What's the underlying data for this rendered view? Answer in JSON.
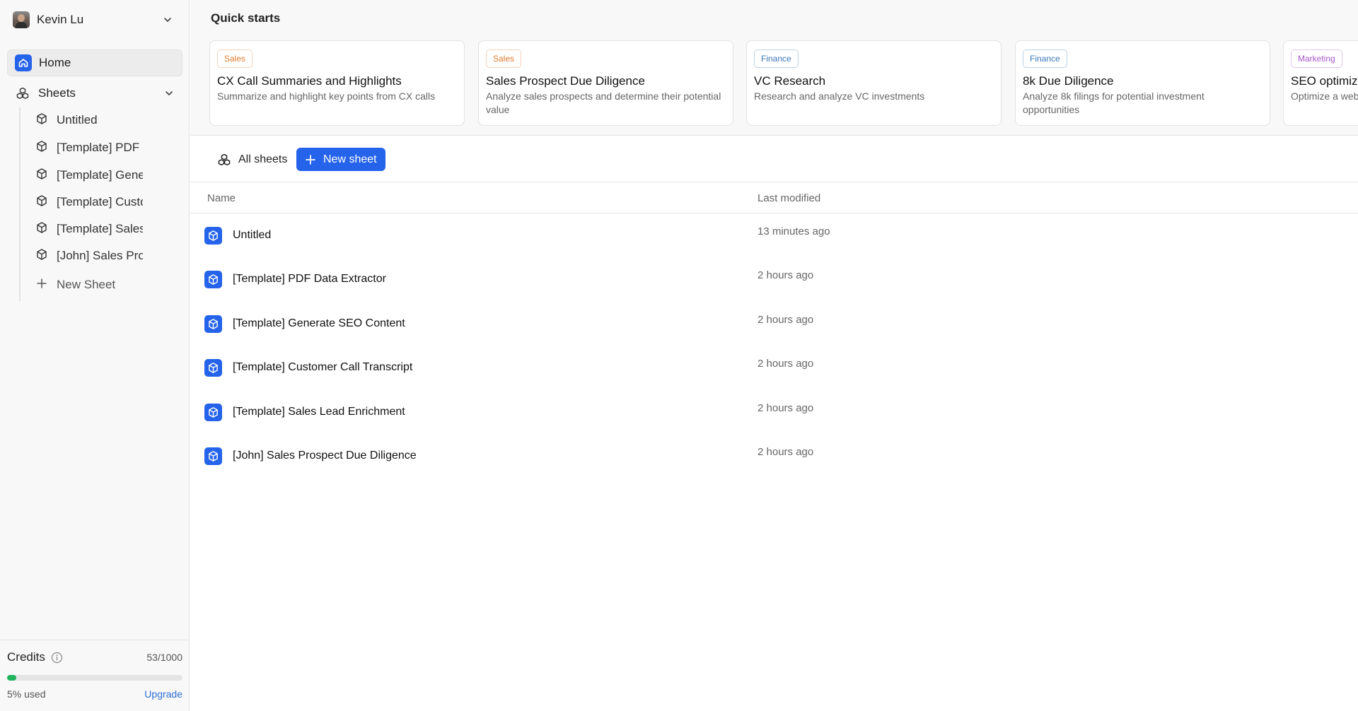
{
  "user": {
    "name": "Kevin Lu"
  },
  "nav": {
    "home_label": "Home",
    "sheets_label": "Sheets",
    "sheet_items": [
      "Untitled",
      "[Template] PDF Data Extractor",
      "[Template] Generate SEO Content",
      "[Template] Customer Call Transcript",
      "[Template] Sales Lead Enrichment",
      "[John] Sales Prospect Due Diligence"
    ],
    "new_sheet_label": "New Sheet"
  },
  "credits": {
    "title": "Credits",
    "count": "53/1000",
    "used_fraction": 0.053,
    "used_text": "5% used",
    "upgrade_label": "Upgrade",
    "bar_color": "#22b35e"
  },
  "quick_starts": {
    "title": "Quick starts",
    "cards": [
      {
        "tag": "Sales",
        "tag_color": "#e07b2c",
        "title": "CX Call Summaries and Highlights",
        "desc": "Summarize and highlight key points from CX calls"
      },
      {
        "tag": "Sales",
        "tag_color": "#e07b2c",
        "title": "Sales Prospect Due Diligence",
        "desc": "Analyze sales prospects and determine their potential value"
      },
      {
        "tag": "Finance",
        "tag_color": "#3a78b8",
        "title": "VC Research",
        "desc": "Research and analyze VC investments"
      },
      {
        "tag": "Finance",
        "tag_color": "#3a78b8",
        "title": "8k Due Diligence",
        "desc": "Analyze 8k filings for potential investment opportunities"
      },
      {
        "tag": "Marketing",
        "tag_color": "#a855c7",
        "title": "SEO optimization",
        "desc": "Optimize a website for search engines"
      }
    ]
  },
  "toolbar": {
    "all_sheets_label": "All sheets",
    "new_sheet_button": "New sheet",
    "accent": "#2563eb"
  },
  "table": {
    "columns": {
      "name": "Name",
      "modified": "Last modified"
    },
    "rows": [
      {
        "name": "Untitled",
        "modified": "13 minutes ago"
      },
      {
        "name": "[Template] PDF Data Extractor",
        "modified": "2 hours ago"
      },
      {
        "name": "[Template] Generate SEO Content",
        "modified": "2 hours ago"
      },
      {
        "name": "[Template] Customer Call Transcript",
        "modified": "2 hours ago"
      },
      {
        "name": "[Template] Sales Lead Enrichment",
        "modified": "2 hours ago"
      },
      {
        "name": "[John] Sales Prospect Due Diligence",
        "modified": "2 hours ago"
      }
    ]
  },
  "icons": {
    "sheet": "cube-icon",
    "home": "home-icon",
    "sheets_group": "cubes-icon",
    "add": "plus-icon",
    "expand": "chevron-down-icon",
    "info": "info-icon"
  }
}
